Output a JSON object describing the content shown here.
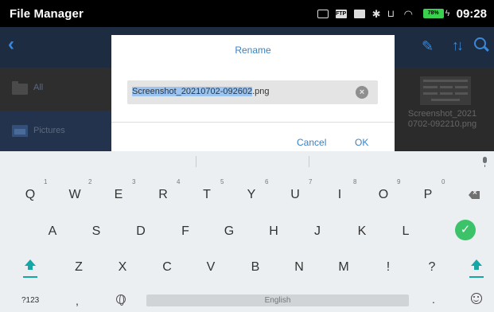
{
  "statusbar": {
    "app_title": "File Manager",
    "ftp_label": "FTP",
    "battery_level": "78%",
    "time": "09:28"
  },
  "app": {
    "sidebar": {
      "items": [
        {
          "label": "All",
          "icon": "folder-icon"
        },
        {
          "label": "Pictures",
          "icon": "image-icon"
        }
      ]
    },
    "file": {
      "name_line1": "Screenshot_2021",
      "name_line2": "0702-092210.png"
    }
  },
  "dialog": {
    "title": "Rename",
    "input_selected": "Screenshot_20210702-092602",
    "input_ext": ".png",
    "cancel_label": "Cancel",
    "ok_label": "OK"
  },
  "keyboard": {
    "row1": [
      "Q",
      "W",
      "E",
      "R",
      "T",
      "Y",
      "U",
      "I",
      "O",
      "P"
    ],
    "row1_hints": [
      "1",
      "2",
      "3",
      "4",
      "5",
      "6",
      "7",
      "8",
      "9",
      "0"
    ],
    "row2": [
      "A",
      "S",
      "D",
      "F",
      "G",
      "H",
      "J",
      "K",
      "L"
    ],
    "row3": [
      "Z",
      "X",
      "C",
      "V",
      "B",
      "N",
      "M",
      "!",
      "?"
    ],
    "symbols_label": "?123",
    "comma": ",",
    "space_label": "English",
    "period": "."
  },
  "colors": {
    "accent": "#3a82c4",
    "done_green": "#3cc36a",
    "shift_teal": "#17a6a6"
  }
}
